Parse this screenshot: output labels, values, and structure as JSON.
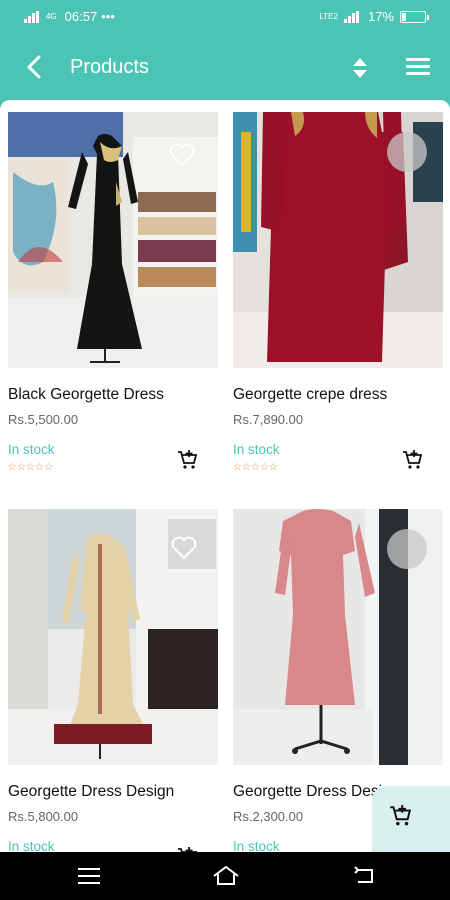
{
  "status": {
    "time": "06:57",
    "dots": "•••",
    "net_left": "4G",
    "net_right": "LTE2",
    "battery": "17%"
  },
  "appbar": {
    "title": "Products",
    "back_icon": "chevron-left-icon",
    "sort_icon": "sort-icon",
    "menu_icon": "hamburger-menu-icon"
  },
  "products": [
    {
      "name": "Black Georgette Dress",
      "price": "Rs.5,500.00",
      "stock": "In stock",
      "rating": "☆☆☆☆☆"
    },
    {
      "name": "Georgette crepe dress",
      "price": "Rs.7,890.00",
      "stock": "In stock",
      "rating": "☆☆☆☆☆"
    },
    {
      "name": "Georgette Dress Design",
      "price": "Rs.5,800.00",
      "stock": "In stock",
      "rating": "☆☆☆☆☆"
    },
    {
      "name": "Georgette Dress Design",
      "price": "Rs.2,300.00",
      "stock": "In stock",
      "rating": "☆☆☆☆☆"
    }
  ],
  "colors": {
    "accent": "#4cc4b4",
    "rating": "#d4932a"
  }
}
